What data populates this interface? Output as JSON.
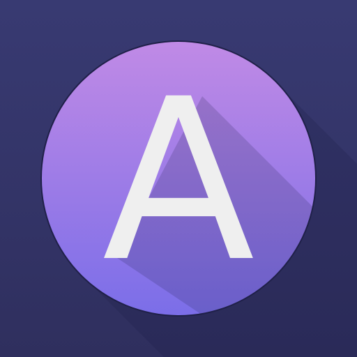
{
  "icon": {
    "name": "letter-a-app-icon",
    "glyph": "A"
  },
  "colors": {
    "background_top": "#383a72",
    "background_bottom": "#2f2f5e",
    "circle_top": "#c08ae6",
    "circle_bottom": "#7b6ee8",
    "circle_outline": "#1f2048",
    "letter": "#efefef",
    "long_shadow": "#1c1c44"
  }
}
